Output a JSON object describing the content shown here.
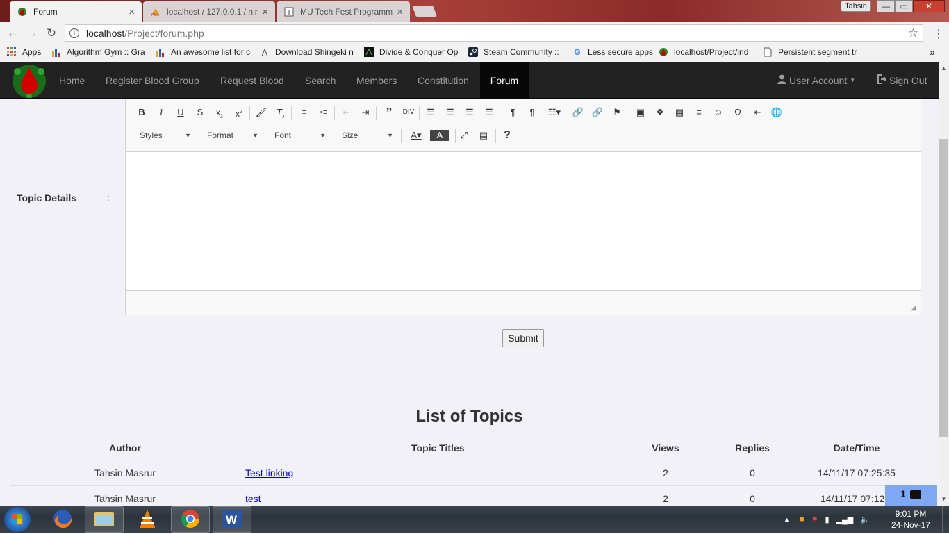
{
  "browser": {
    "tabs": [
      {
        "title": "Forum",
        "icon": "blood-drop-icon",
        "close": "×",
        "active": true
      },
      {
        "title": "localhost / 127.0.0.1 / nir",
        "icon": "phpmyadmin-icon",
        "close": "×",
        "active": false
      },
      {
        "title": "MU Tech Fest Programm",
        "icon": "typeform-icon",
        "close": "×",
        "active": false
      }
    ],
    "profile_name": "Tahsin",
    "window_controls": {
      "minimize": "—",
      "maximize": "▭",
      "close": "✕"
    },
    "url": {
      "host": "localhost",
      "path": "/Project/forum.php"
    },
    "bookmarks": [
      {
        "label": "Apps",
        "icon": "apps-grid-icon"
      },
      {
        "label": "Algorithm Gym :: Gra",
        "icon": "bar-chart-icon"
      },
      {
        "label": "An awesome list for c",
        "icon": "bar-chart-icon"
      },
      {
        "label": "Download Shingeki n",
        "icon": "anime-icon"
      },
      {
        "label": "Divide & Conquer Op",
        "icon": "dc-icon"
      },
      {
        "label": "Steam Community ::",
        "icon": "steam-icon"
      },
      {
        "label": "Less secure apps",
        "icon": "google-icon"
      },
      {
        "label": "localhost/Project/ind",
        "icon": "blood-drop-icon"
      },
      {
        "label": "Persistent segment tr",
        "icon": "page-icon"
      }
    ],
    "bookmarks_more": "»"
  },
  "site_nav": {
    "items": [
      {
        "label": "Home",
        "active": false
      },
      {
        "label": "Register Blood Group",
        "active": false
      },
      {
        "label": "Request Blood",
        "active": false
      },
      {
        "label": "Search",
        "active": false
      },
      {
        "label": "Members",
        "active": false
      },
      {
        "label": "Constitution",
        "active": false
      },
      {
        "label": "Forum",
        "active": true
      }
    ],
    "user_account": "User Account",
    "sign_out": "Sign Out"
  },
  "form": {
    "topic_details_label": "Topic Details",
    "colon": ":",
    "editor": {
      "style_combos": [
        "Styles",
        "Format",
        "Font",
        "Size"
      ],
      "content": ""
    },
    "submit_label": "Submit"
  },
  "topics": {
    "title": "List of Topics",
    "columns": [
      "Author",
      "Topic Titles",
      "Views",
      "Replies",
      "Date/Time"
    ],
    "rows": [
      {
        "author": "Tahsin Masrur",
        "title": "Test linking",
        "views": "2",
        "replies": "0",
        "datetime": "14/11/17 07:25:35"
      },
      {
        "author": "Tahsin Masrur",
        "title": "test",
        "views": "2",
        "replies": "0",
        "datetime": "14/11/17 07:12:3"
      }
    ]
  },
  "chat_widget": {
    "badge": "1"
  },
  "taskbar": {
    "apps": [
      {
        "name": "Firefox",
        "icon": "firefox-icon"
      },
      {
        "name": "File Explorer",
        "icon": "folder-icon"
      },
      {
        "name": "VLC",
        "icon": "vlc-icon"
      },
      {
        "name": "Chrome",
        "icon": "chrome-icon"
      },
      {
        "name": "Word",
        "icon": "word-icon"
      }
    ],
    "time": "9:01 PM",
    "date": "24-Nov-17"
  },
  "colors": {
    "nav_bg": "#222222",
    "nav_active": "#080808",
    "link": "#337ab7",
    "page_bg": "#f1f1f7",
    "chat_accent": "#7ea8f2"
  }
}
